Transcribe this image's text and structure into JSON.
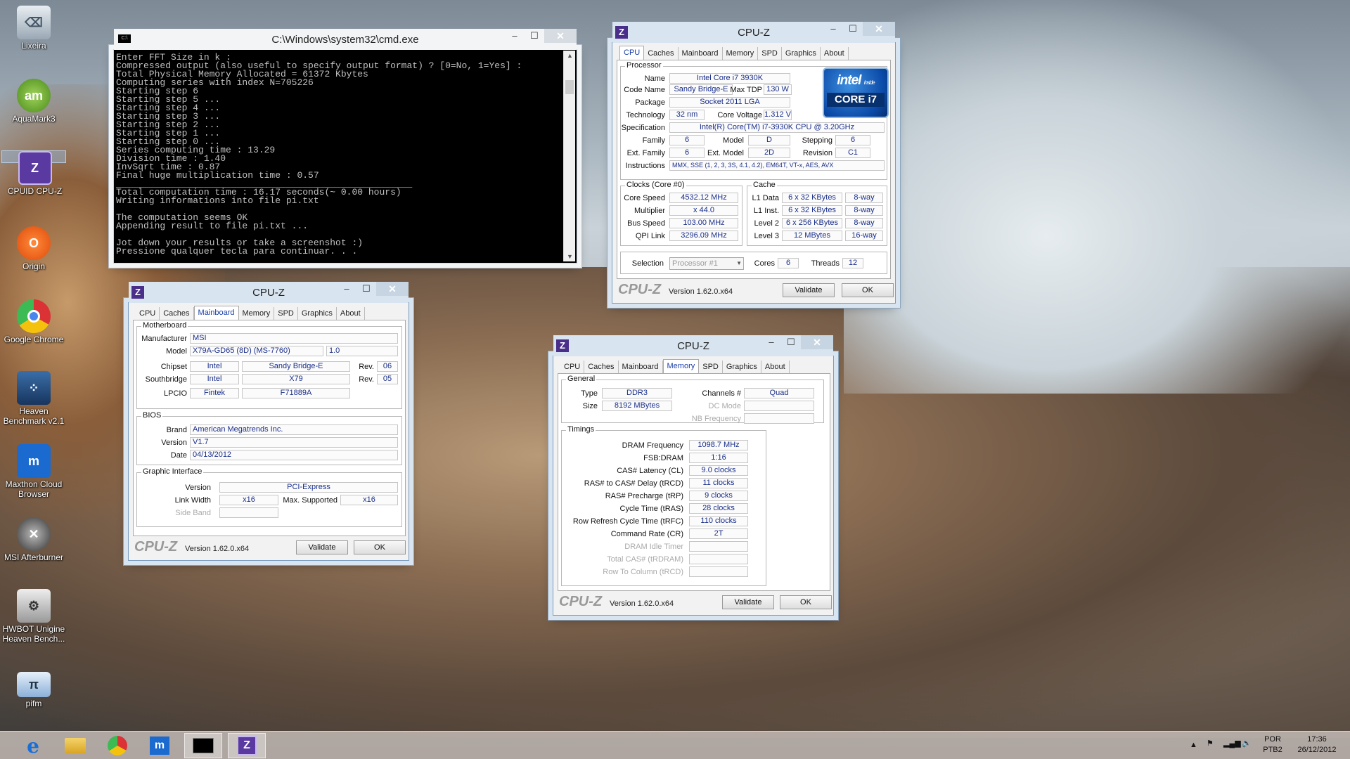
{
  "desktop": {
    "icons": [
      {
        "label": "Lixeira",
        "icon": "recycle-bin-icon"
      },
      {
        "label": "AquaMark3",
        "icon": "aquamark-icon"
      },
      {
        "label": "CPUID CPU-Z",
        "icon": "cpuz-icon"
      },
      {
        "label": "Origin",
        "icon": "origin-icon"
      },
      {
        "label": "Google Chrome",
        "icon": "chrome-icon"
      },
      {
        "label": "Heaven Benchmark v2.1",
        "icon": "heaven-icon"
      },
      {
        "label": "Maxthon Cloud Browser",
        "icon": "maxthon-icon"
      },
      {
        "label": "MSI Afterburner",
        "icon": "afterburner-icon"
      },
      {
        "label": "HWBOT Unigine Heaven Bench...",
        "icon": "hwbot-icon"
      },
      {
        "label": "pifm",
        "icon": "pifm-icon"
      }
    ]
  },
  "cmd": {
    "title": "C:\\Windows\\system32\\cmd.exe",
    "icon_label": "C:\\",
    "lines": [
      "Enter FFT Size in k :",
      "Compressed output (also useful to specify output format) ? [0=No, 1=Yes] :",
      "Total Physical Memory Allocated = 61372 Kbytes",
      "Computing series with index N=705226",
      "Starting step 6",
      "Starting step 5 ...",
      "Starting step 4 ...",
      "Starting step 3 ...",
      "Starting step 2 ...",
      "Starting step 1 ...",
      "Starting step 0 ...",
      "Series computing time : 13.29",
      "Division time : 1.40",
      "InvSqrt time : 0.87",
      "Final huge multiplication time : 0.57",
      "______________________________________________________",
      "Total computation time : 16.17 seconds(~ 0.00 hours)",
      "Writing informations into file pi.txt",
      "",
      "The computation seems OK",
      "Appending result to file pi.txt ...",
      "",
      "Jot down your results or take a screenshot :)",
      "Pressione qualquer tecla para continuar. . ."
    ]
  },
  "cpuz_common": {
    "title": "CPU-Z",
    "tabs": [
      "CPU",
      "Caches",
      "Mainboard",
      "Memory",
      "SPD",
      "Graphics",
      "About"
    ],
    "logo": "CPU-Z",
    "version": "Version 1.62.0.x64",
    "validate": "Validate",
    "ok": "OK",
    "z": "Z"
  },
  "cpu": {
    "processor": "Processor",
    "name_l": "Name",
    "name": "Intel Core i7 3930K",
    "codename_l": "Code Name",
    "codename": "Sandy Bridge-E",
    "maxtdp_l": "Max TDP",
    "maxtdp": "130 W",
    "package_l": "Package",
    "package": "Socket 2011 LGA",
    "tech_l": "Technology",
    "tech": "32 nm",
    "voltage_l": "Core Voltage",
    "voltage": "1.312 V",
    "spec_l": "Specification",
    "spec": "Intel(R) Core(TM) i7-3930K CPU @ 3.20GHz",
    "family_l": "Family",
    "family": "6",
    "model_l": "Model",
    "model": "D",
    "stepping_l": "Stepping",
    "stepping": "6",
    "extfamily_l": "Ext. Family",
    "extfamily": "6",
    "extmodel_l": "Ext. Model",
    "extmodel": "2D",
    "revision_l": "Revision",
    "revision": "C1",
    "instr_l": "Instructions",
    "instr": "MMX, SSE (1, 2, 3, 3S, 4.1, 4.2), EM64T, VT-x, AES, AVX",
    "clocks": "Clocks (Core #0)",
    "corespeed_l": "Core Speed",
    "corespeed": "4532.12 MHz",
    "mult_l": "Multiplier",
    "mult": "x 44.0",
    "bus_l": "Bus Speed",
    "bus": "103.00 MHz",
    "qpi_l": "QPI Link",
    "qpi": "3296.09 MHz",
    "cache": "Cache",
    "l1d_l": "L1 Data",
    "l1d": "6 x 32 KBytes",
    "l1d_w": "8-way",
    "l1i_l": "L1 Inst.",
    "l1i": "6 x 32 KBytes",
    "l1i_w": "8-way",
    "l2_l": "Level 2",
    "l2": "6 x 256 KBytes",
    "l2_w": "8-way",
    "l3_l": "Level 3",
    "l3": "12 MBytes",
    "l3_w": "16-way",
    "selection_l": "Selection",
    "selection": "Processor #1",
    "cores_l": "Cores",
    "cores": "6",
    "threads_l": "Threads",
    "threads": "12",
    "intel_top": "intel",
    "intel_inside": "inside",
    "intel_core": "CORE i7"
  },
  "mainboard": {
    "motherboard": "Motherboard",
    "manufacturer_l": "Manufacturer",
    "manufacturer": "MSI",
    "model_l": "Model",
    "model": "X79A-GD65 (8D) (MS-7760)",
    "model_rev": "1.0",
    "chipset_l": "Chipset",
    "chipset_v": "Intel",
    "chipset": "Sandy Bridge-E",
    "rev_l": "Rev.",
    "chipset_rev": "06",
    "south_l": "Southbridge",
    "south_v": "Intel",
    "south": "X79",
    "south_rev": "05",
    "lpcio_l": "LPCIO",
    "lpcio_v": "Fintek",
    "lpcio": "F71889A",
    "bios": "BIOS",
    "brand_l": "Brand",
    "brand": "American Megatrends Inc.",
    "version_l": "Version",
    "version": "V1.7",
    "date_l": "Date",
    "date": "04/13/2012",
    "gi": "Graphic Interface",
    "giver_l": "Version",
    "giver": "PCI-Express",
    "lw_l": "Link Width",
    "lw": "x16",
    "ms_l": "Max. Supported",
    "ms": "x16",
    "sb_l": "Side Band"
  },
  "memory": {
    "general": "General",
    "type_l": "Type",
    "type": "DDR3",
    "size_l": "Size",
    "size": "8192 MBytes",
    "channels_l": "Channels #",
    "channels": "Quad",
    "dc_l": "DC Mode",
    "nb_l": "NB Frequency",
    "timings": "Timings",
    "rows": [
      {
        "l": "DRAM Frequency",
        "v": "1098.7 MHz",
        "dim": false
      },
      {
        "l": "FSB:DRAM",
        "v": "1:16",
        "dim": false
      },
      {
        "l": "CAS# Latency (CL)",
        "v": "9.0 clocks",
        "dim": false
      },
      {
        "l": "RAS# to CAS# Delay (tRCD)",
        "v": "11 clocks",
        "dim": false
      },
      {
        "l": "RAS# Precharge (tRP)",
        "v": "9 clocks",
        "dim": false
      },
      {
        "l": "Cycle Time (tRAS)",
        "v": "28 clocks",
        "dim": false
      },
      {
        "l": "Row Refresh Cycle Time (tRFC)",
        "v": "110 clocks",
        "dim": false
      },
      {
        "l": "Command Rate (CR)",
        "v": "2T",
        "dim": false
      },
      {
        "l": "DRAM Idle Timer",
        "v": "",
        "dim": true
      },
      {
        "l": "Total CAS# (tRDRAM)",
        "v": "",
        "dim": true
      },
      {
        "l": "Row To Column (tRCD)",
        "v": "",
        "dim": true
      }
    ]
  },
  "taskbar": {
    "lang1": "POR",
    "lang2": "PTB2",
    "time": "17:36",
    "date": "26/12/2012",
    "buttons": [
      "ie-icon",
      "explorer-icon",
      "chrome-icon",
      "maxthon-icon",
      "cmd-icon",
      "cpuz-icon"
    ]
  }
}
